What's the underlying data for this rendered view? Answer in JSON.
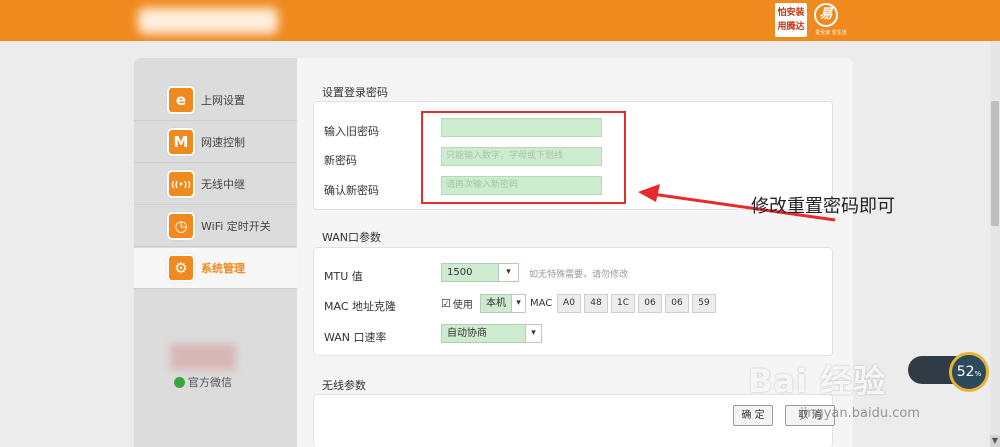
{
  "header": {
    "badge1_line1": "怕安装",
    "badge1_line2": "用腾达",
    "badge2": "易",
    "badge2_sub": "爱全家 爱生活"
  },
  "sidebar": {
    "items": [
      {
        "label": "上网设置",
        "icon": "internet-e-icon",
        "glyph": "e"
      },
      {
        "label": "网速控制",
        "icon": "speed-control-icon",
        "glyph": "M"
      },
      {
        "label": "无线中继",
        "icon": "wireless-relay-icon",
        "glyph": "((•))"
      },
      {
        "label": "WiFi 定时开关",
        "icon": "wifi-timer-icon",
        "glyph": "◷"
      },
      {
        "label": "系统管理",
        "icon": "system-gear-icon",
        "glyph": "⚙"
      }
    ],
    "wechat_label": "官方微信"
  },
  "login_password": {
    "title": "设置登录密码",
    "old_label": "输入旧密码",
    "old_value": "",
    "new_label": "新密码",
    "new_placeholder": "只能输入数字，字母或下划线",
    "confirm_label": "确认新密码",
    "confirm_placeholder": "请再次输入新密码"
  },
  "wan": {
    "title": "WAN口参数",
    "mtu_label": "MTU 值",
    "mtu_value": "1500",
    "mtu_hint": "如无特殊需要，请勿修改",
    "mac_label": "MAC 地址克隆",
    "mac_use_label": "使用",
    "mac_source": "本机",
    "mac_prefix": "MAC",
    "mac_parts": [
      "A0",
      "48",
      "1C",
      "06",
      "06",
      "59"
    ],
    "speed_label": "WAN 口速率",
    "speed_value": "自动协商"
  },
  "wireless": {
    "title": "无线参数"
  },
  "buttons": {
    "ok": "确 定",
    "cancel": "取 消"
  },
  "annotation": "修改重置密码即可",
  "watermark": {
    "brand": "Bai 经验",
    "url": "jingyan.baidu.com",
    "gauge_value": "52",
    "gauge_unit": "%"
  },
  "colors": {
    "brand_orange": "#f08a1e",
    "input_green": "#cdebcf",
    "annotation_red": "#e52b2b"
  }
}
